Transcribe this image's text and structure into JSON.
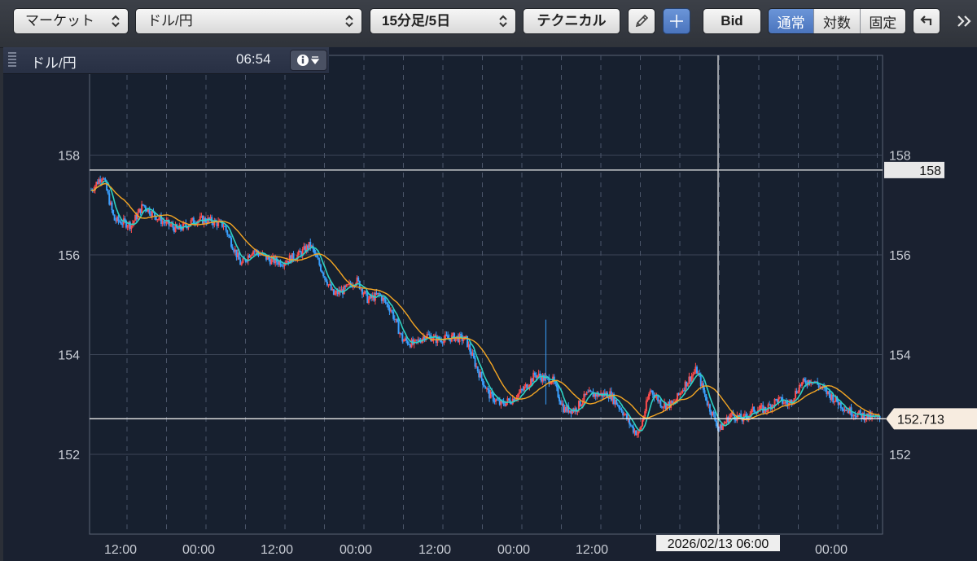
{
  "toolbar": {
    "market_select": "マーケット",
    "symbol_select": "ドル/円",
    "period_select": "15分足/5日",
    "technical_button": "テクニカル",
    "bid_button": "Bid",
    "scale_modes": [
      {
        "label": "通常",
        "active": true
      },
      {
        "label": "対数",
        "active": false
      },
      {
        "label": "固定",
        "active": false
      }
    ],
    "icons": [
      "pencil-icon",
      "crosshair-icon",
      "undo-icon",
      "double-chevron-right-icon"
    ]
  },
  "info_bar": {
    "symbol": "ドル/円",
    "time": "06:54"
  },
  "chart_data": {
    "type": "candlestick",
    "symbol": "ドル/円",
    "y_ticks_left": [
      "158",
      "156",
      "154",
      "152"
    ],
    "y_ticks_right": [
      "158",
      "156",
      "154",
      "152"
    ],
    "ylim": [
      150.4,
      160.0
    ],
    "x_ticks": [
      "12:00",
      "00:00",
      "12:00",
      "00:00",
      "12:00",
      "00:00",
      "12:00",
      "00:00",
      "00:00"
    ],
    "crosshair": {
      "price_label": "158",
      "price": 157.7,
      "time_label": "2026/02/13 06:00"
    },
    "current_price": {
      "label": "152.713",
      "value": 152.713
    },
    "close_series": [
      {
        "x": 0,
        "y": 157.3
      },
      {
        "x": 4,
        "y": 157.6
      },
      {
        "x": 8,
        "y": 156.7
      },
      {
        "x": 14,
        "y": 156.6
      },
      {
        "x": 18,
        "y": 157.0
      },
      {
        "x": 24,
        "y": 156.7
      },
      {
        "x": 30,
        "y": 156.5
      },
      {
        "x": 36,
        "y": 156.7
      },
      {
        "x": 40,
        "y": 156.7
      },
      {
        "x": 46,
        "y": 156.6
      },
      {
        "x": 52,
        "y": 155.8
      },
      {
        "x": 56,
        "y": 156.1
      },
      {
        "x": 62,
        "y": 155.9
      },
      {
        "x": 66,
        "y": 155.85
      },
      {
        "x": 72,
        "y": 156.0
      },
      {
        "x": 76,
        "y": 156.2
      },
      {
        "x": 80,
        "y": 155.7
      },
      {
        "x": 84,
        "y": 155.2
      },
      {
        "x": 88,
        "y": 155.3
      },
      {
        "x": 92,
        "y": 155.5
      },
      {
        "x": 96,
        "y": 155.1
      },
      {
        "x": 100,
        "y": 155.2
      },
      {
        "x": 104,
        "y": 154.9
      },
      {
        "x": 108,
        "y": 154.3
      },
      {
        "x": 112,
        "y": 154.2
      },
      {
        "x": 116,
        "y": 154.4
      },
      {
        "x": 120,
        "y": 154.3
      },
      {
        "x": 126,
        "y": 154.35
      },
      {
        "x": 130,
        "y": 154.3
      },
      {
        "x": 134,
        "y": 153.7
      },
      {
        "x": 138,
        "y": 153.2
      },
      {
        "x": 142,
        "y": 153.0
      },
      {
        "x": 146,
        "y": 153.1
      },
      {
        "x": 150,
        "y": 153.3
      },
      {
        "x": 154,
        "y": 153.6
      },
      {
        "x": 158,
        "y": 153.5
      },
      {
        "x": 160,
        "y": 153.5
      },
      {
        "x": 164,
        "y": 152.9
      },
      {
        "x": 168,
        "y": 152.9
      },
      {
        "x": 172,
        "y": 153.2
      },
      {
        "x": 176,
        "y": 153.2
      },
      {
        "x": 180,
        "y": 153.2
      },
      {
        "x": 184,
        "y": 152.9
      },
      {
        "x": 188,
        "y": 152.5
      },
      {
        "x": 190,
        "y": 152.4
      },
      {
        "x": 194,
        "y": 153.3
      },
      {
        "x": 198,
        "y": 153.0
      },
      {
        "x": 202,
        "y": 153.0
      },
      {
        "x": 206,
        "y": 153.4
      },
      {
        "x": 210,
        "y": 153.7
      },
      {
        "x": 214,
        "y": 153.0
      },
      {
        "x": 218,
        "y": 152.5
      },
      {
        "x": 222,
        "y": 152.8
      },
      {
        "x": 226,
        "y": 152.7
      },
      {
        "x": 230,
        "y": 152.9
      },
      {
        "x": 234,
        "y": 152.9
      },
      {
        "x": 238,
        "y": 153.1
      },
      {
        "x": 242,
        "y": 153.0
      },
      {
        "x": 246,
        "y": 153.4
      },
      {
        "x": 250,
        "y": 153.5
      },
      {
        "x": 254,
        "y": 153.3
      },
      {
        "x": 258,
        "y": 153.1
      },
      {
        "x": 262,
        "y": 152.9
      },
      {
        "x": 266,
        "y": 152.8
      },
      {
        "x": 270,
        "y": 152.75
      },
      {
        "x": 274,
        "y": 152.7
      }
    ],
    "moving_averages": [
      {
        "name": "short",
        "color": "#2ed3c4"
      },
      {
        "name": "long",
        "color": "#f5a623"
      }
    ],
    "candle_colors": {
      "up": "#ff4d4d",
      "down": "#3aa0ff"
    },
    "grid": true
  }
}
